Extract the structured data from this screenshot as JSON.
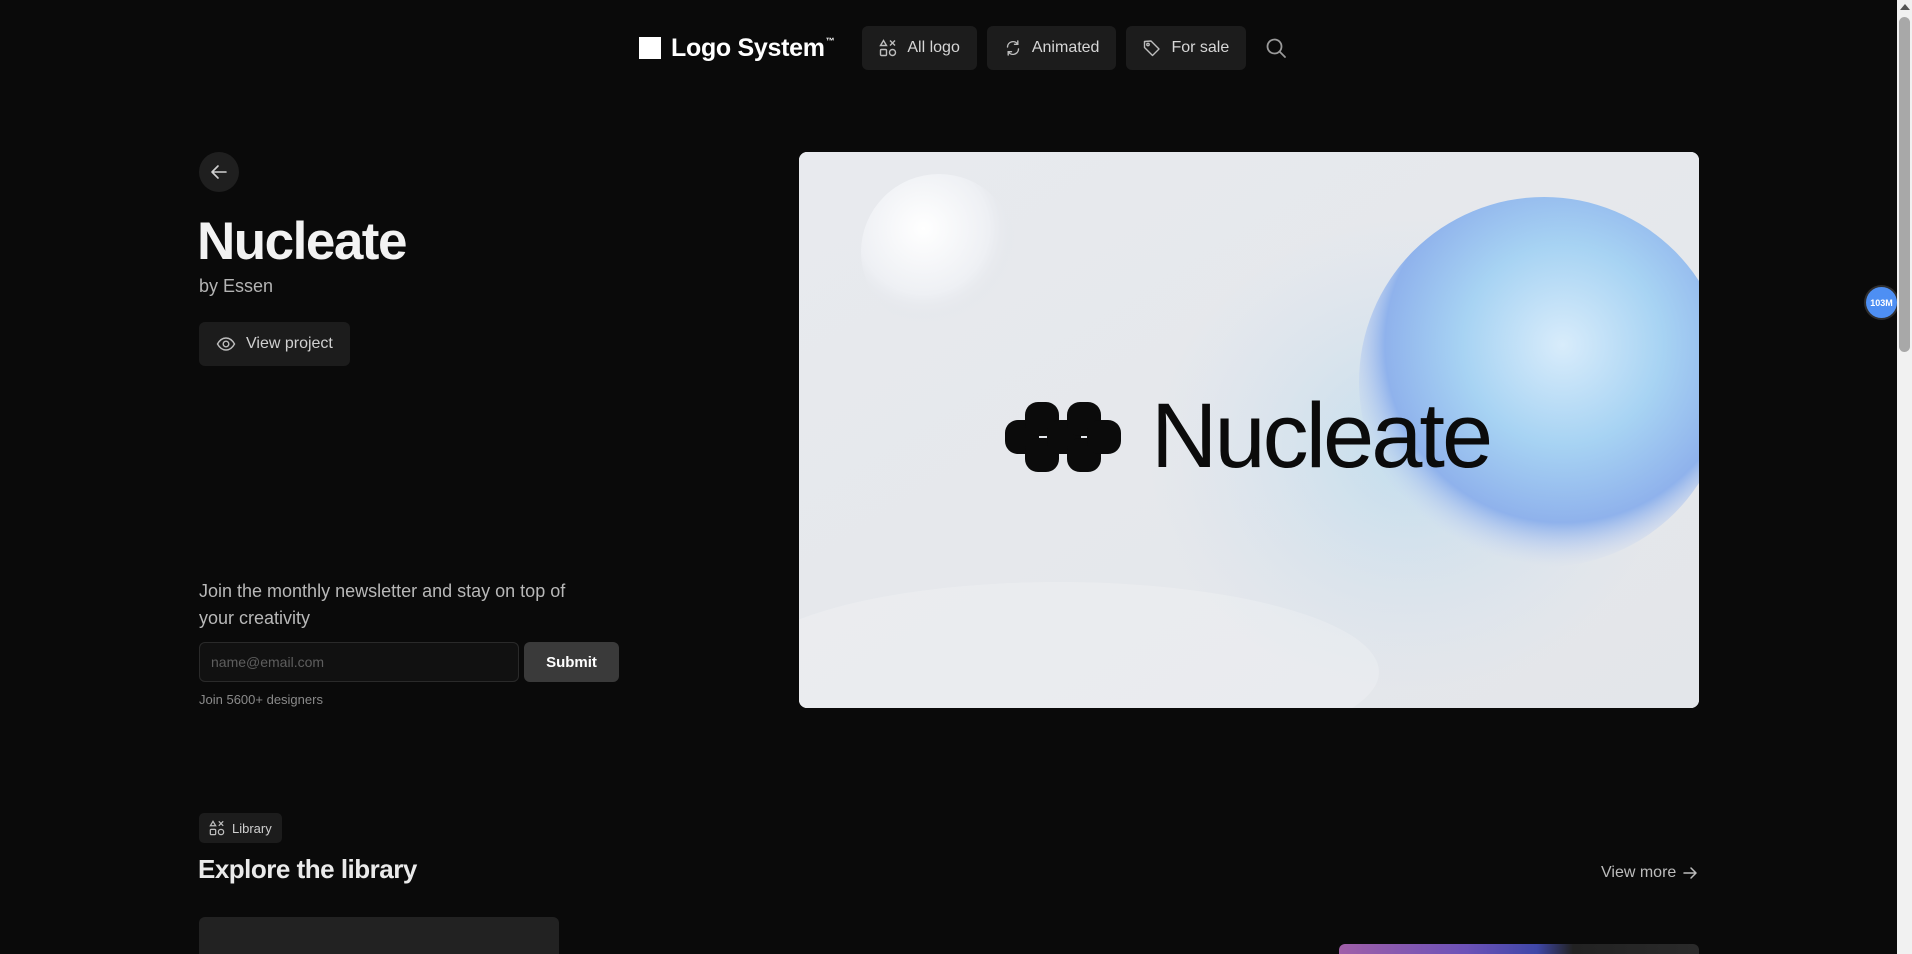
{
  "nav": {
    "brand": "Logo System",
    "brand_tm": "™",
    "items": [
      {
        "label": "All logo",
        "icon": "grid-shapes-icon"
      },
      {
        "label": "Animated",
        "icon": "refresh-icon"
      },
      {
        "label": "For sale",
        "icon": "tag-icon"
      }
    ],
    "search_icon": "search-icon"
  },
  "project": {
    "title": "Nucleate",
    "byline": "by Essen",
    "view_project_label": "View project"
  },
  "hero": {
    "wordmark": "Nucleate"
  },
  "newsletter": {
    "text": "Join the monthly newsletter and stay on top of your creativity",
    "placeholder": "name@email.com",
    "submit_label": "Submit",
    "note": "Join 5600+ designers"
  },
  "badge": {
    "text": "103M",
    "color": "#4e8ff3"
  },
  "library": {
    "tag": "Library",
    "title": "Explore the library",
    "view_more": "View more"
  }
}
